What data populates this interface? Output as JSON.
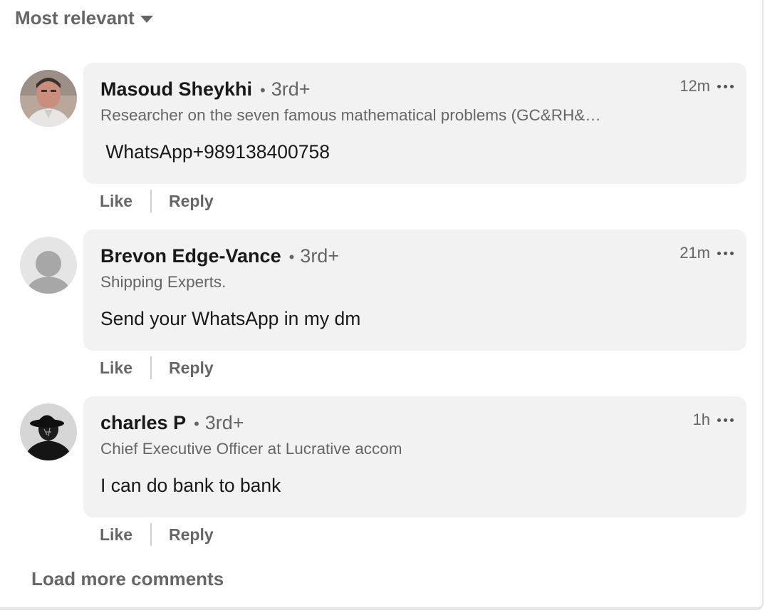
{
  "sort": {
    "label": "Most relevant"
  },
  "comments": [
    {
      "author": "Masoud Sheykhi",
      "degree": "3rd+",
      "headline": "Researcher on the seven famous mathematical problems (GC&RH&…",
      "time": "12m",
      "text": " WhatsApp+989138400758",
      "actions": {
        "like": "Like",
        "reply": "Reply"
      }
    },
    {
      "author": "Brevon Edge-Vance",
      "degree": "3rd+",
      "headline": "Shipping Experts.",
      "time": "21m",
      "text": "Send your WhatsApp in my dm",
      "actions": {
        "like": "Like",
        "reply": "Reply"
      }
    },
    {
      "author": "charles P",
      "degree": "3rd+",
      "headline": "Chief Executive Officer at Lucrative accom",
      "time": "1h",
      "text": "I can do bank to bank",
      "actions": {
        "like": "Like",
        "reply": "Reply"
      }
    }
  ],
  "load_more": {
    "label": "Load more comments"
  },
  "icons": {
    "sort": "caret-down-icon",
    "more": "ellipsis-icon"
  },
  "colors": {
    "bubble_bg": "#f2f2f2",
    "primary_text": "#191919",
    "secondary_text": "#666666"
  }
}
